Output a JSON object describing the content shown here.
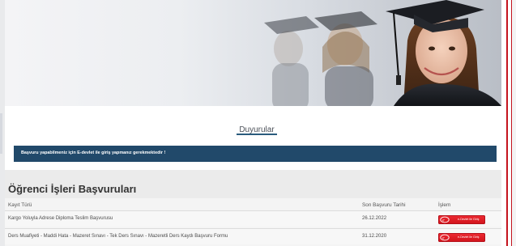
{
  "tabs": {
    "active_label": "Duyurular"
  },
  "notice": {
    "text": "Başvuru yapabilmeniz için E-devlet ile giriş yapmanız gerekmektedir !"
  },
  "section": {
    "title": "Öğrenci İşleri Başvuruları",
    "columns": [
      "Kayıt Türü",
      "Son Başvuru Tarihi",
      "İşlem"
    ],
    "rows": [
      {
        "type": "Kargo Yoluyla Adrese Diploma Teslim Başvurusu",
        "deadline": "26.12.2022",
        "action": "e-Devlet ile Giriş"
      },
      {
        "type": "Ders Muafiyeti - Maddi Hata - Mazeret Sınavı - Tek Ders Sınavı - Mazeretli Ders Kaydı Başvuru Formu",
        "deadline": "31.12.2020",
        "action": "e-Devlet ile Giriş"
      }
    ]
  },
  "colors": {
    "notice_bg": "#21496a",
    "accent_border": "#c4141e",
    "button": "#e11d25",
    "tab_underline": "#2a5b7d"
  },
  "icons": {
    "hero": "graduates-photo",
    "button": "edevlet-logo-icon"
  }
}
